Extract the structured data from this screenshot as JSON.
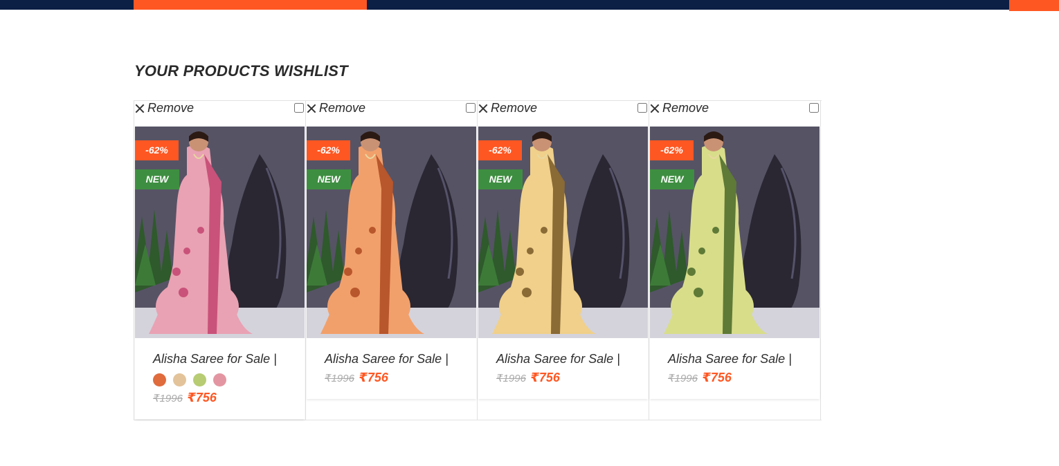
{
  "heading": "YOUR PRODUCTS WISHLIST",
  "colors": {
    "accent": "#ff5722",
    "navy": "#0c1f45",
    "new_badge": "#3e8e41"
  },
  "items": [
    {
      "remove_label": "Remove",
      "discount": "-62%",
      "tag": "NEW",
      "name": "Alisha Saree for Sale |",
      "old_price": "₹1996",
      "price": "₹756",
      "saree_color": "#e9a2b3",
      "saree_dark": "#c9527a",
      "swatches": [
        "#e06b3d",
        "#e3c39a",
        "#b7cc73",
        "#e396a1"
      ]
    },
    {
      "remove_label": "Remove",
      "discount": "-62%",
      "tag": "NEW",
      "name": "Alisha Saree for Sale |",
      "old_price": "₹1996",
      "price": "₹756",
      "saree_color": "#f2a06b",
      "saree_dark": "#b8562c",
      "swatches": []
    },
    {
      "remove_label": "Remove",
      "discount": "-62%",
      "tag": "NEW",
      "name": "Alisha Saree for Sale |",
      "old_price": "₹1996",
      "price": "₹756",
      "saree_color": "#f0d08a",
      "saree_dark": "#8a6a35",
      "swatches": []
    },
    {
      "remove_label": "Remove",
      "discount": "-62%",
      "tag": "NEW",
      "name": "Alisha Saree for Sale |",
      "old_price": "₹1996",
      "price": "₹756",
      "saree_color": "#d8dd8a",
      "saree_dark": "#5e7a36",
      "swatches": []
    }
  ]
}
